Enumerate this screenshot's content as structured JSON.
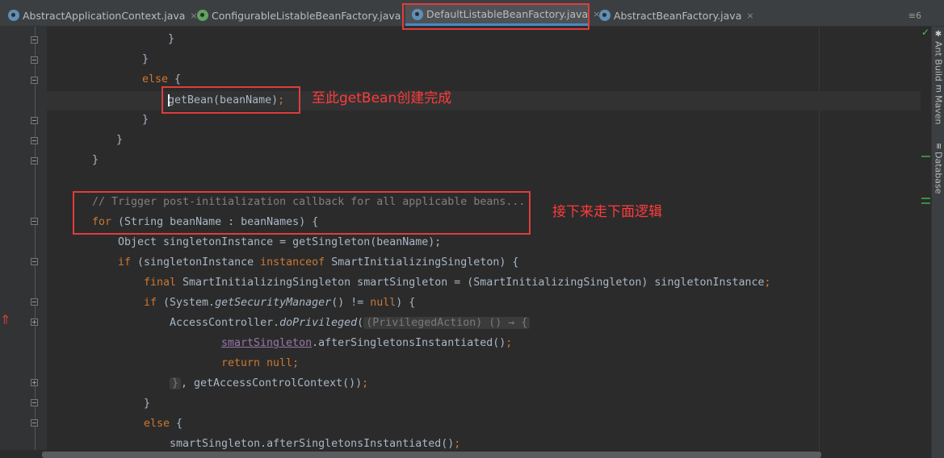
{
  "tabs": [
    {
      "label": "AbstractApplicationContext.java",
      "close": "×"
    },
    {
      "label": "ConfigurableListableBeanFactory.java",
      "close": "×"
    },
    {
      "label": "DefaultListableBeanFactory.java",
      "close": "×"
    },
    {
      "label": "AbstractBeanFactory.java",
      "close": "×"
    }
  ],
  "tab_overflow": "≡6",
  "code": {
    "l1": "}",
    "l2": "}",
    "l3_kw": "else",
    "l3_rest": " {",
    "l4_call": "getBean",
    "l4_rest": "(beanName)",
    "l4_semi": ";",
    "l5": "}",
    "l6": "}",
    "l7": "}",
    "l9": "// Trigger post-initialization callback for all applicable beans...",
    "l10_kw": "for",
    "l10_rest": " (String beanName : beanNames) {",
    "l11": "Object singletonInstance = getSingleton(beanName);",
    "l11_semi": ";",
    "l12_kw": "if",
    "l12_a": " (singletonInstance ",
    "l12_kw2": "instanceof",
    "l12_b": " SmartInitializingSingleton) {",
    "l13_kw": "final",
    "l13_rest": " SmartInitializingSingleton smartSingleton = (SmartInitializingSingleton) singletonInstance",
    "l13_semi": ";",
    "l14_kw": "if",
    "l14_a": " (System.",
    "l14_it": "getSecurityManager",
    "l14_b": "() != ",
    "l14_kw2": "null",
    "l14_c": ") {",
    "l15_a": "AccessController.",
    "l15_it": "doPrivileged",
    "l15_b": "(",
    "l15_hint": "(PrivilegedAction) () → {",
    "l16_var": "smartSingleton",
    "l16_rest": ".afterSingletonsInstantiated()",
    "l16_semi": ";",
    "l17_kw": "return null",
    "l17_semi": ";",
    "l18_a": "}",
    "l18_b": ", getAccessControlContext())",
    "l18_semi": ";",
    "l19": "}",
    "l20_kw": "else",
    "l20_rest": " {",
    "l21": "smartSingleton.afterSingletonsInstantiated()",
    "l21_semi": ";"
  },
  "annotations": {
    "first": "至此getBean创建完成",
    "second": "接下来走下面逻辑"
  },
  "gutter_arrow": "⇑",
  "status_check": "✓",
  "right_tools": [
    {
      "label": "Ant Build",
      "icon": "ant-icon"
    },
    {
      "label": "Maven",
      "icon": "maven-icon"
    },
    {
      "label": "Database",
      "icon": "database-icon"
    }
  ],
  "colors": {
    "background": "#2b2b2b",
    "keyword": "#cc7832",
    "comment": "#808080",
    "annotation_red": "#e03c3c",
    "active_tab_underline": "#4a88c7"
  }
}
